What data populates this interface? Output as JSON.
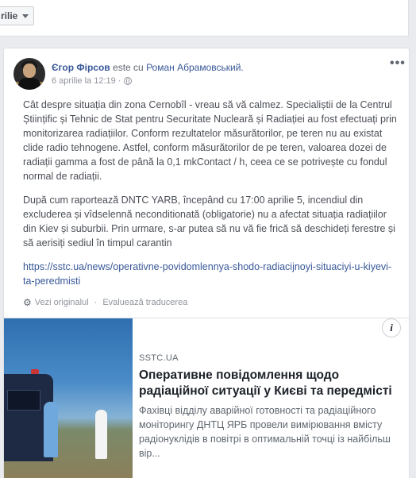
{
  "filter": {
    "label": "rilie"
  },
  "post": {
    "author": "Єгор Фірсов",
    "with_text": "este cu",
    "tagged": "Роман Абрамовський.",
    "date": "6 aprilie la 12:19 ·",
    "more_label": "•••",
    "paragraph1": "Cât despre situația din zona Cernobîl - vreau să vă calmez. Specialiștii de la Centrul Științific și Tehnic de Stat pentru Securitate Nucleară și Radiației au fost efectuați prin monitorizarea radiațiilor. Conform rezultatelor măsurătorilor, pe teren nu au existat clide radio tehnogene. Astfel, conform măsurătorilor de pe teren, valoarea dozei de radiații gamma a fost de până la 0,1 mkContact / h, ceea ce se potrivește cu fondul normal de radiații.",
    "paragraph2": "După cum raportează DNTC YARB, începând cu 17:00 aprilie 5, incendiul din excluderea și vîdselennă neconditionată (obligatorie) nu a afectat situația radiațiilor din Kiev și suburbii. Prin urmare, s-ar putea să nu vă fie frică să deschideți ferestre și să aerisiți sediul în timpul carantin",
    "link": "https://sstc.ua/news/operativne-povidomlennya-shodo-radiacijnoyi-situaciyi-u-kiyevi-ta-peredmisti",
    "see_original": "Vezi originalul",
    "separator": "·",
    "rate_translation": "Evaluează traducerea"
  },
  "preview": {
    "info_label": "i",
    "domain": "SSTC.UA",
    "title": "Оперативне повідомлення щодо радіаційної ситуації у Києві та передмісті",
    "description": "Фахівці відділу аварійної готовності та радіаційного моніторингу ДНТЦ ЯРБ провели вимірювання вмісту радіонуклідів в повітрі в оптимальній точці із найбільш вір..."
  }
}
